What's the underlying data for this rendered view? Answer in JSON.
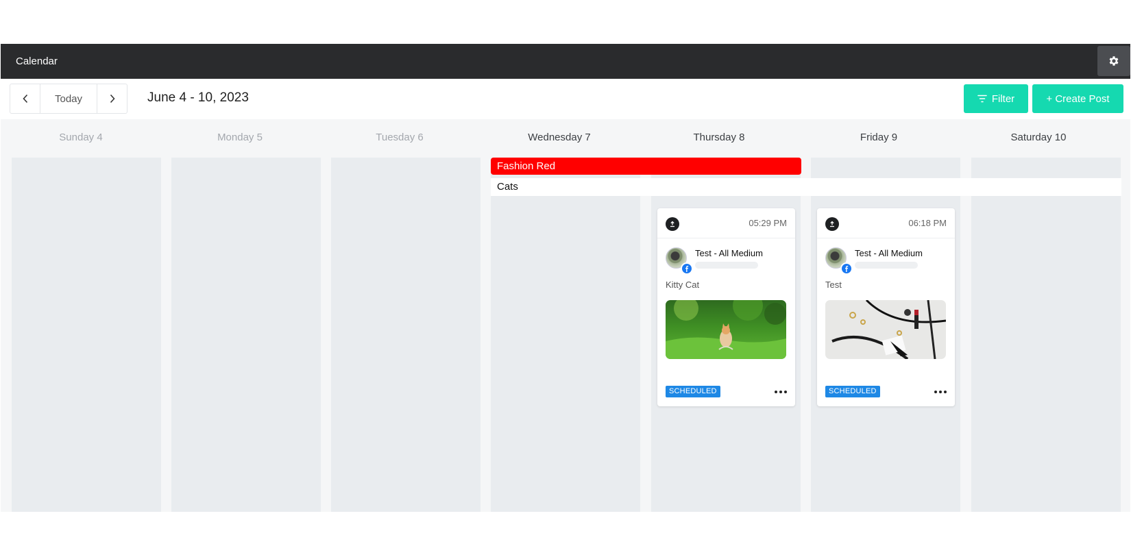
{
  "header": {
    "title": "Calendar",
    "settings_icon": "gear-icon"
  },
  "toolbar": {
    "prev_icon": "chevron-left-icon",
    "today_label": "Today",
    "next_icon": "chevron-right-icon",
    "date_range": "June 4 - 10, 2023",
    "filter_label": "Filter",
    "filter_icon": "filter-icon",
    "create_label": "+ Create Post"
  },
  "days": [
    {
      "label": "Sunday 4",
      "state": "past"
    },
    {
      "label": "Monday 5",
      "state": "past"
    },
    {
      "label": "Tuesday 6",
      "state": "past"
    },
    {
      "label": "Wednesday 7",
      "state": "current"
    },
    {
      "label": "Thursday 8",
      "state": "current"
    },
    {
      "label": "Friday 9",
      "state": "current"
    },
    {
      "label": "Saturday 10",
      "state": "current"
    }
  ],
  "events": [
    {
      "title": "Fashion Red",
      "color": "#ff0000"
    },
    {
      "title": "Cats",
      "color": "#ffffff"
    }
  ],
  "posts": [
    {
      "time": "05:29 PM",
      "account": "Test - All Medium",
      "network_icon": "facebook-icon",
      "caption": "Kitty Cat",
      "image": "kitten-in-grass",
      "status": "SCHEDULED"
    },
    {
      "time": "06:18 PM",
      "account": "Test - All Medium",
      "network_icon": "facebook-icon",
      "caption": "Test",
      "image": "fashion-accessories",
      "status": "SCHEDULED"
    }
  ],
  "colors": {
    "accent": "#15d9b0",
    "topbar": "#2a2b2d",
    "scheduled": "#1e88e5",
    "facebook": "#1877f2"
  }
}
